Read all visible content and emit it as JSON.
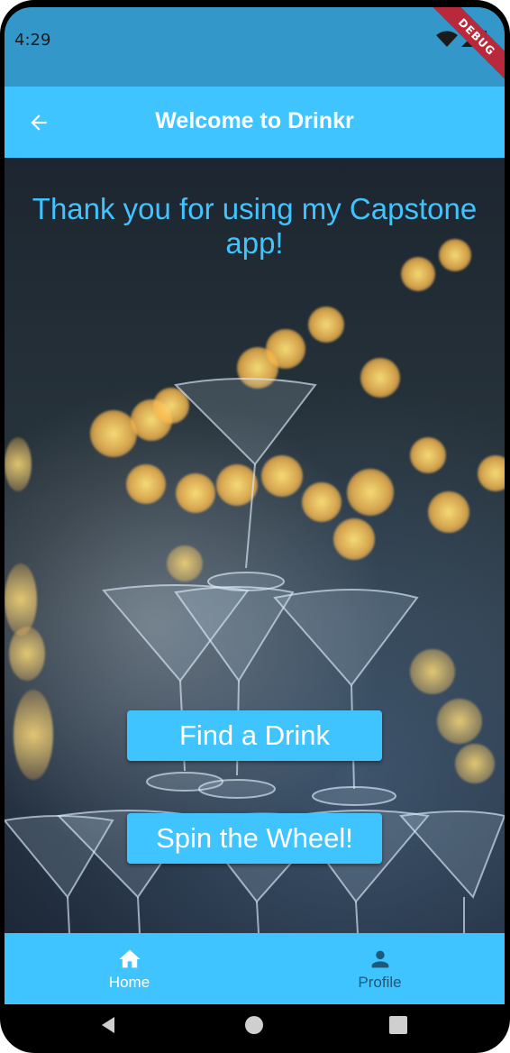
{
  "status_bar": {
    "time": "4:29",
    "debug_label": "DEBUG"
  },
  "app_bar": {
    "title": "Welcome to Drinkr",
    "back_icon": "arrow-back-icon"
  },
  "main": {
    "welcome_message": "Thank you for using my Capstone app!",
    "buttons": {
      "find_drink": "Find a Drink",
      "spin_wheel": "Spin the Wheel!"
    },
    "background_image": "cocktail-glasses-bokeh"
  },
  "bottom_nav": {
    "items": [
      {
        "label": "Home",
        "icon": "home-icon",
        "active": true
      },
      {
        "label": "Profile",
        "icon": "person-icon",
        "active": false
      }
    ]
  },
  "colors": {
    "accent": "#40c4ff",
    "status_bar": "#3497c9",
    "debug_banner": "#b9293b"
  }
}
